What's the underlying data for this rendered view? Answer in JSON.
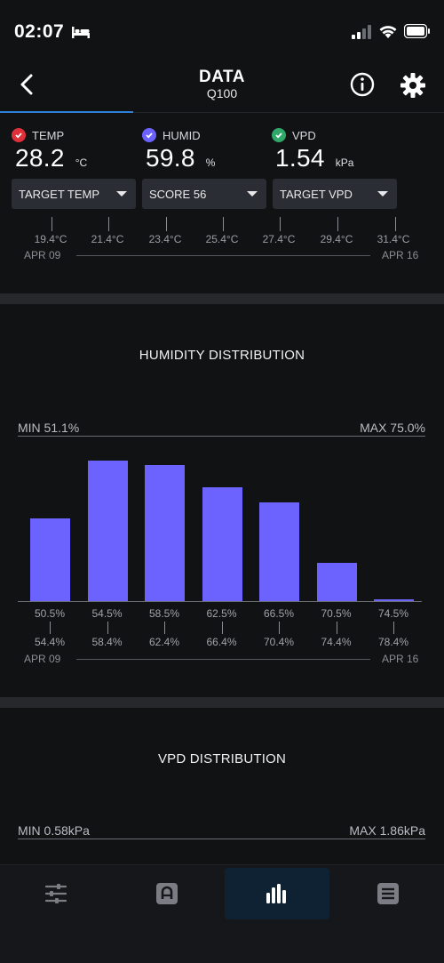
{
  "status_bar": {
    "time": "02:07"
  },
  "header": {
    "title": "DATA",
    "subtitle": "Q100"
  },
  "metrics": {
    "temp": {
      "label": "TEMP",
      "value": "28.2",
      "unit": "°C",
      "check_color": "#e0303a"
    },
    "humid": {
      "label": "HUMID",
      "value": "59.8",
      "unit": "%",
      "check_color": "#6c63ff"
    },
    "vpd": {
      "label": "VPD",
      "value": "1.54",
      "unit": "kPa",
      "check_color": "#2fa86a"
    }
  },
  "dropdowns": {
    "target_temp": "TARGET TEMP",
    "score": "SCORE 56",
    "target_vpd": "TARGET VPD"
  },
  "temp_axis": {
    "ticks": [
      "19.4°C",
      "21.4°C",
      "23.4°C",
      "25.4°C",
      "27.4°C",
      "29.4°C",
      "31.4°C"
    ],
    "start_date": "APR 09",
    "end_date": "APR 16"
  },
  "humidity": {
    "title": "HUMIDITY DISTRIBUTION",
    "min": "MIN 51.1%",
    "max": "MAX 75.0%",
    "bar_color": "#6c63ff",
    "start_date": "APR 09",
    "end_date": "APR 16"
  },
  "chart_data": {
    "type": "bar",
    "categories": [
      "50.5%-54.4%",
      "54.5%-58.4%",
      "58.5%-62.4%",
      "62.5%-66.4%",
      "66.5%-70.4%",
      "70.5%-74.4%",
      "74.5%-78.4%"
    ],
    "bin_low": [
      "50.5%",
      "54.5%",
      "58.5%",
      "62.5%",
      "66.5%",
      "70.5%",
      "74.5%"
    ],
    "bin_high": [
      "54.4%",
      "58.4%",
      "62.4%",
      "66.4%",
      "70.4%",
      "74.4%",
      "78.4%"
    ],
    "values": [
      0.59,
      1.0,
      0.97,
      0.81,
      0.7,
      0.27,
      0.01
    ],
    "title": "HUMIDITY DISTRIBUTION"
  },
  "vpd": {
    "title": "VPD DISTRIBUTION",
    "min": "MIN 0.58kPa",
    "max": "MAX 1.86kPa"
  },
  "tab_bar": {
    "active_color": "#0f2233",
    "icons": [
      "sliders-icon",
      "grow-icon",
      "chart-icon",
      "list-icon"
    ]
  }
}
